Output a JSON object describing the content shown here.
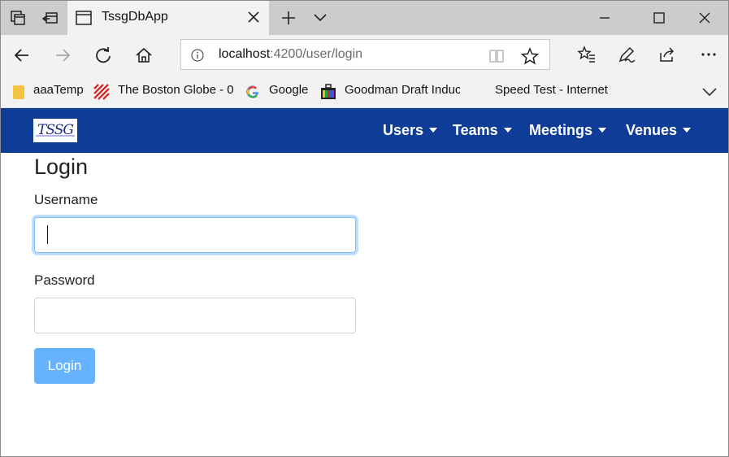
{
  "browser": {
    "tab": {
      "title": "TssgDbApp"
    },
    "address": {
      "host": "localhost",
      "path": ":4200/user/login"
    },
    "favorites": [
      {
        "label": "aaaTemp",
        "icon": "folder-icon"
      },
      {
        "label": "The Boston Globe - 0",
        "icon": "boston-globe-icon"
      },
      {
        "label": "Google",
        "icon": "google-icon"
      },
      {
        "label": "Goodman Draft Induc",
        "icon": "briefcase-icon"
      },
      {
        "label": "Speed Test - Internet",
        "icon": ""
      }
    ]
  },
  "app": {
    "brand": "TSSG",
    "nav": [
      {
        "label": "Users"
      },
      {
        "label": "Teams"
      },
      {
        "label": "Meetings"
      },
      {
        "label": "Venues"
      }
    ],
    "colors": {
      "navbar": "#0e3c96",
      "button": "#66b2ff",
      "focus": "#80bdff"
    }
  },
  "login": {
    "title": "Login",
    "username_label": "Username",
    "username_value": "",
    "password_label": "Password",
    "password_value": "",
    "submit_label": "Login"
  }
}
